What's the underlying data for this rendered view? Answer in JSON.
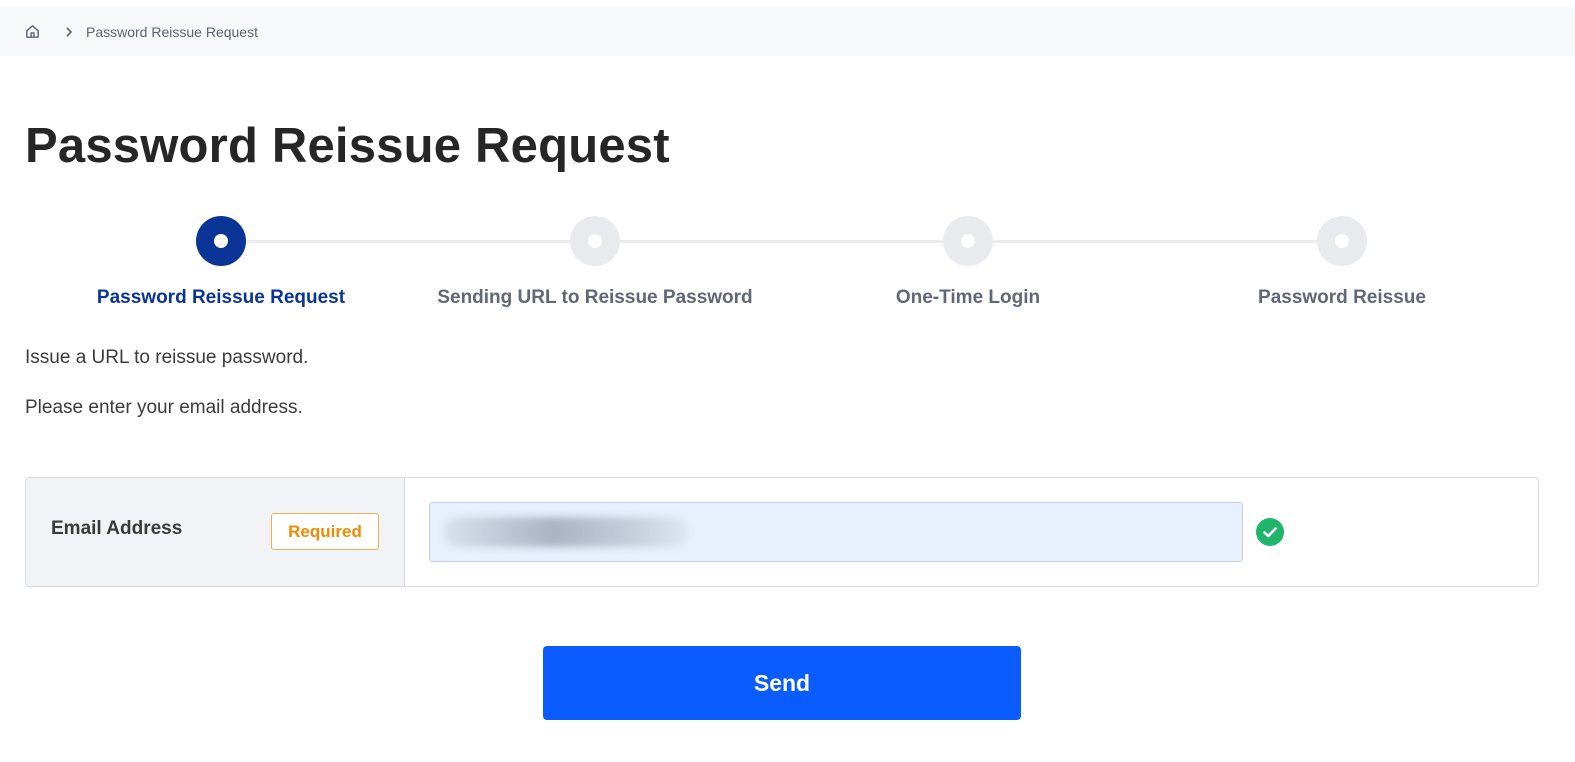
{
  "breadcrumb": {
    "home_icon": "home-icon",
    "separator_icon": "chevron-right-icon",
    "current": "Password Reissue Request"
  },
  "page_title": "Password Reissue Request",
  "stepper": {
    "active_index": 0,
    "active_color": "#0a3597",
    "inactive_color": "#e9eaee",
    "steps": [
      {
        "label": "Password Reissue Request",
        "state": "active"
      },
      {
        "label": "Sending URL to Reissue Password",
        "state": "inactive"
      },
      {
        "label": "One-Time Login",
        "state": "inactive"
      },
      {
        "label": "Password Reissue",
        "state": "inactive"
      }
    ]
  },
  "description": {
    "line1": "Issue a URL to reissue password.",
    "line2": "Please enter your email address."
  },
  "form": {
    "email": {
      "label": "Email Address",
      "required_label": "Required",
      "value": "",
      "value_redacted": true,
      "validation_icon": "check-circle-icon",
      "validation_state": "valid"
    }
  },
  "actions": {
    "send_label": "Send",
    "send_color": "#0b5cff"
  }
}
